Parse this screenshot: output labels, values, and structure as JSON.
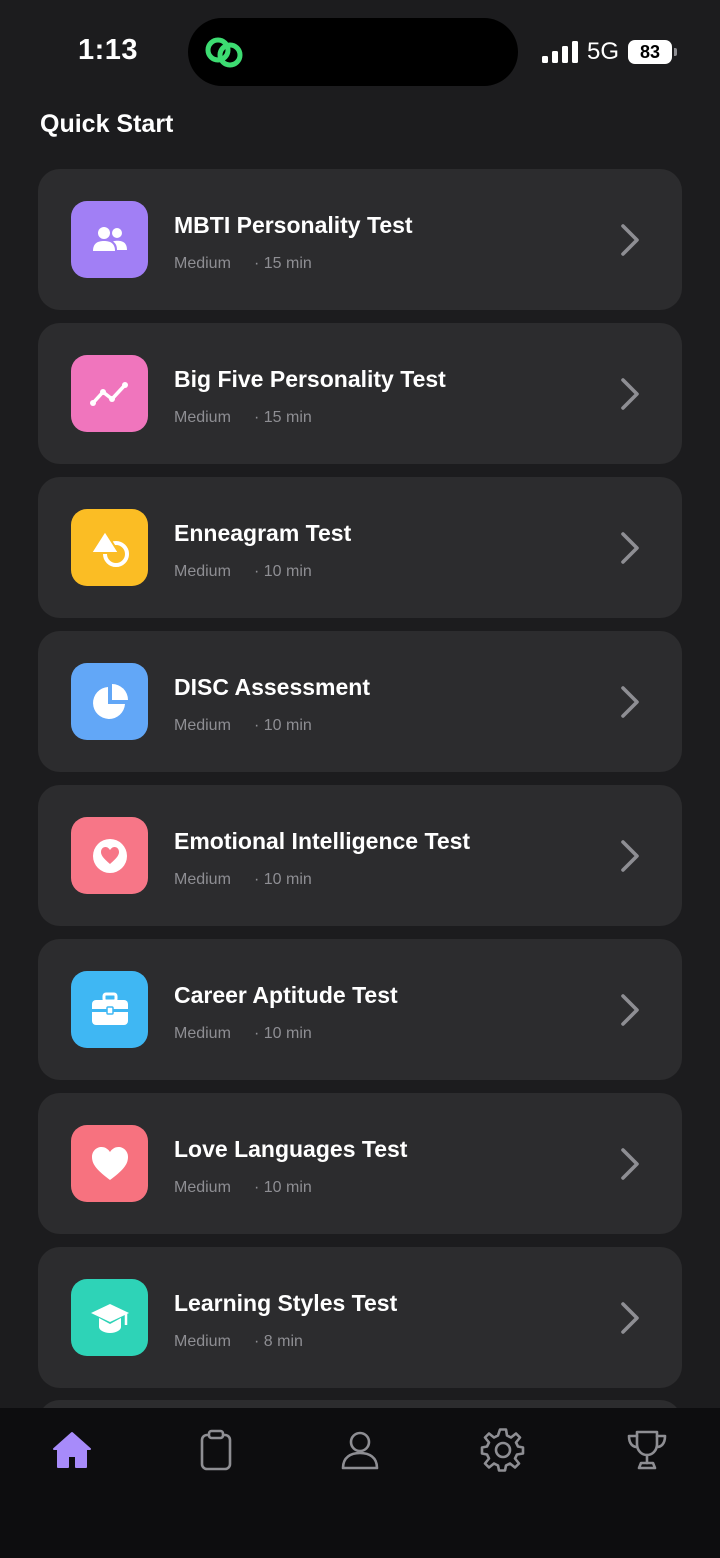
{
  "status_bar": {
    "time": "1:13",
    "network": "5G",
    "battery": "83"
  },
  "section_title": "Quick Start",
  "tests": [
    {
      "title": "MBTI Personality Test",
      "difficulty": "Medium",
      "duration": "· 15 min",
      "icon": "people-icon",
      "color": "#a17ff5"
    },
    {
      "title": "Big Five Personality Test",
      "difficulty": "Medium",
      "duration": "· 15 min",
      "icon": "trend-line-icon",
      "color": "#f075bd"
    },
    {
      "title": "Enneagram Test",
      "difficulty": "Medium",
      "duration": "· 10 min",
      "icon": "shapes-icon",
      "color": "#fbbd24"
    },
    {
      "title": "DISC Assessment",
      "difficulty": "Medium",
      "duration": "· 10 min",
      "icon": "pie-chart-icon",
      "color": "#62a7f7"
    },
    {
      "title": "Emotional Intelligence Test",
      "difficulty": "Medium",
      "duration": "· 10 min",
      "icon": "heart-circle-icon",
      "color": "#f77687"
    },
    {
      "title": "Career Aptitude Test",
      "difficulty": "Medium",
      "duration": "· 10 min",
      "icon": "briefcase-icon",
      "color": "#3fb7f3"
    },
    {
      "title": "Love Languages Test",
      "difficulty": "Medium",
      "duration": "· 10 min",
      "icon": "heart-icon",
      "color": "#f7727f"
    },
    {
      "title": "Learning Styles Test",
      "difficulty": "Medium",
      "duration": "· 8 min",
      "icon": "graduation-cap-icon",
      "color": "#2ed3b7"
    }
  ],
  "tab_bar": {
    "active": "home",
    "items": [
      {
        "id": "home",
        "icon": "home-icon"
      },
      {
        "id": "tests",
        "icon": "clipboard-icon"
      },
      {
        "id": "profile",
        "icon": "person-icon"
      },
      {
        "id": "settings",
        "icon": "gear-icon"
      },
      {
        "id": "achievements",
        "icon": "trophy-icon"
      }
    ]
  },
  "colors": {
    "background": "#1c1c1e",
    "card": "#2c2c2e",
    "accent": "#a78bfa",
    "muted": "#8e8e93",
    "tabbar": "#0d0d0f"
  }
}
